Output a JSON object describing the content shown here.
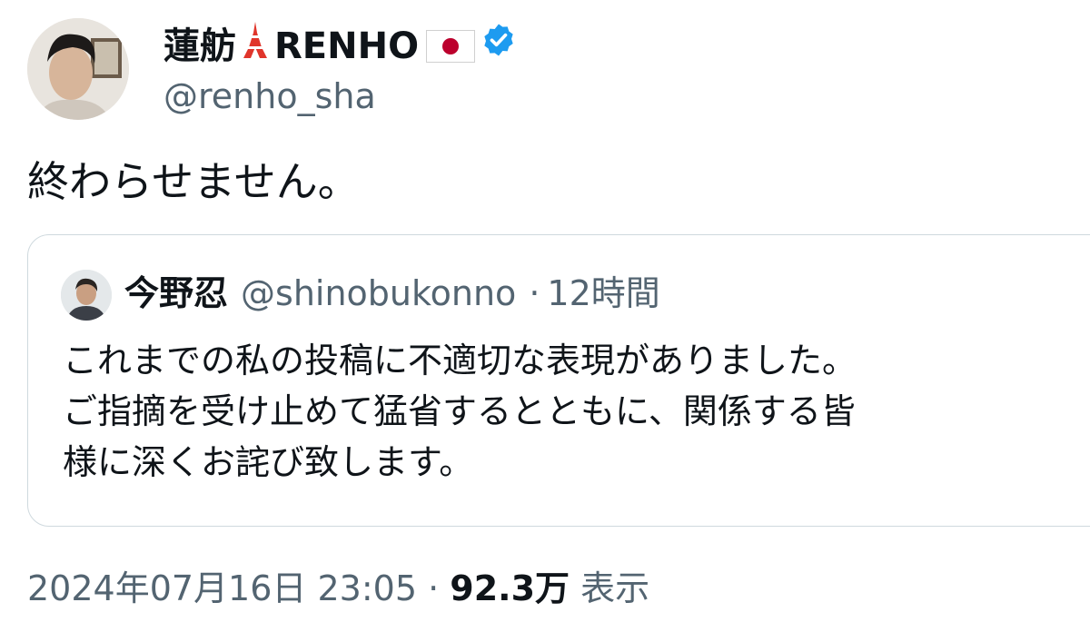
{
  "author": {
    "name": "蓮舫",
    "name_suffix": "RENHO",
    "handle": "@renho_sha",
    "verified": true,
    "verified_color": "#1d9bf0"
  },
  "tweet": {
    "text": "終わらせません。"
  },
  "quoted_tweet": {
    "name": "今野忍",
    "handle": "@shinobukonno",
    "separator": "·",
    "time": "12時間",
    "lines": [
      "これまでの私の投稿に不適切な表現がありました。",
      "ご指摘を受け止めて猛省するとともに、関係する皆",
      "様に深くお詫び致します。"
    ]
  },
  "footer": {
    "datetime": "2024年07月16日 23:05",
    "separator": "·",
    "views_count": "92.3万",
    "views_label": "表示"
  },
  "icons": {
    "tower": "tokyo-tower-emoji",
    "flag": "japan-flag-emoji",
    "badge": "verified-badge-icon"
  },
  "colors": {
    "secondary_text": "#536471",
    "border": "#cfd9de",
    "flag_red": "#bc002d",
    "tower_red": "#e0352b"
  }
}
